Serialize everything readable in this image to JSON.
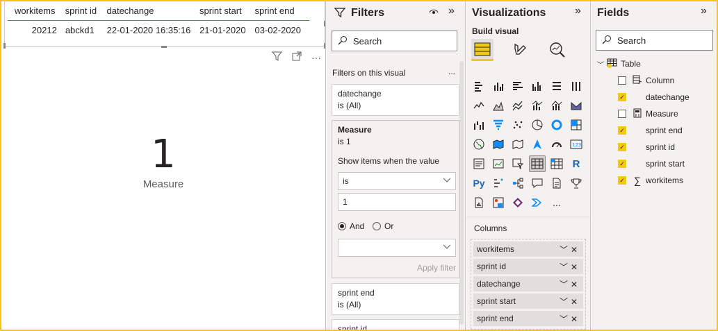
{
  "canvas": {
    "table": {
      "headers": [
        "workitems",
        "sprint id",
        "datechange",
        "sprint start",
        "sprint end"
      ],
      "row": [
        "20212",
        "abckd1",
        "22-01-2020 16:35:16",
        "21-01-2020",
        "03-02-2020"
      ]
    },
    "card": {
      "value": "1",
      "label": "Measure"
    }
  },
  "filters": {
    "title": "Filters",
    "search_placeholder": "Search",
    "section_label": "Filters on this visual",
    "more": "...",
    "datechange": {
      "name": "datechange",
      "value": "is (All)"
    },
    "measure": {
      "name": "Measure",
      "value": "is 1",
      "show_items_label": "Show items when the value",
      "operator": "is",
      "operand": "1",
      "and_label": "And",
      "or_label": "Or",
      "apply_label": "Apply filter"
    },
    "sprint_end": {
      "name": "sprint end",
      "value": "is (All)"
    },
    "sprint_id": {
      "name": "sprint id"
    }
  },
  "visualizations": {
    "title": "Visualizations",
    "tab_label": "Build visual",
    "columns_label": "Columns",
    "more_icon": "...",
    "columns": [
      "workitems",
      "sprint id",
      "datechange",
      "sprint start",
      "sprint end"
    ]
  },
  "fields": {
    "title": "Fields",
    "search_placeholder": "Search",
    "table_name": "Table",
    "items": [
      {
        "label": "Column",
        "checked": false,
        "icon": "calculated-column-icon"
      },
      {
        "label": "datechange",
        "checked": true,
        "icon": ""
      },
      {
        "label": "Measure",
        "checked": false,
        "icon": "measure-calculator-icon"
      },
      {
        "label": "sprint end",
        "checked": true,
        "icon": ""
      },
      {
        "label": "sprint id",
        "checked": true,
        "icon": ""
      },
      {
        "label": "sprint start",
        "checked": true,
        "icon": ""
      },
      {
        "label": "workitems",
        "checked": true,
        "icon": "sigma-icon"
      }
    ]
  },
  "colors": {
    "accent": "#f2c811",
    "selection_line": "#118dff",
    "pane_bg": "#f3f2f1"
  }
}
